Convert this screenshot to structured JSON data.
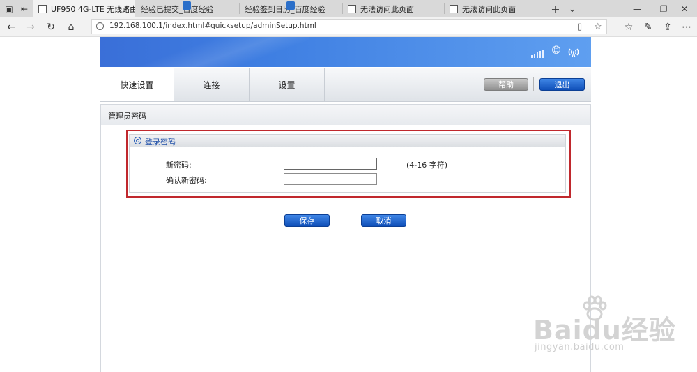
{
  "browser": {
    "tabs": [
      {
        "title": "UF950 4G-LTE 无线路由",
        "icon": "page-icon",
        "active": true
      },
      {
        "title": "经验已提交_百度经验",
        "icon": "baidu-paw-icon",
        "active": false
      },
      {
        "title": "经验签到日历_百度经验",
        "icon": "baidu-paw-icon",
        "active": false
      },
      {
        "title": "无法访问此页面",
        "icon": "page-icon",
        "active": false
      },
      {
        "title": "无法访问此页面",
        "icon": "page-icon",
        "active": false
      }
    ],
    "new_tab": "+",
    "tab_dropdown": "⌄",
    "window_controls": {
      "minimize": "—",
      "restore": "❐",
      "close": "✕"
    },
    "url": "192.168.100.1/index.html#quicksetup/adminSetup.html"
  },
  "router": {
    "menu": {
      "tabs": [
        "快速设置",
        "连接",
        "设置"
      ],
      "active_tab": "快速设置",
      "help_label": "帮助",
      "logout_label": "退出"
    },
    "page_title": "管理员密码",
    "section": {
      "title": "登录密码",
      "new_password_label": "新密码:",
      "new_password_value": "",
      "new_password_hint": "(4-16 字符)",
      "confirm_password_label": "确认新密码:",
      "confirm_password_value": ""
    },
    "buttons": {
      "save": "保存",
      "cancel": "取消"
    },
    "status_icons": [
      "signal-icon",
      "globe-icon",
      "wifi-antenna-icon"
    ]
  },
  "watermark": {
    "main": "Baidu经验",
    "sub": "jingyan.baidu.com"
  },
  "colors": {
    "accent_blue": "#1b5fcc",
    "banner_blue": "#3f7fe2",
    "highlight_red": "#c0282d"
  }
}
